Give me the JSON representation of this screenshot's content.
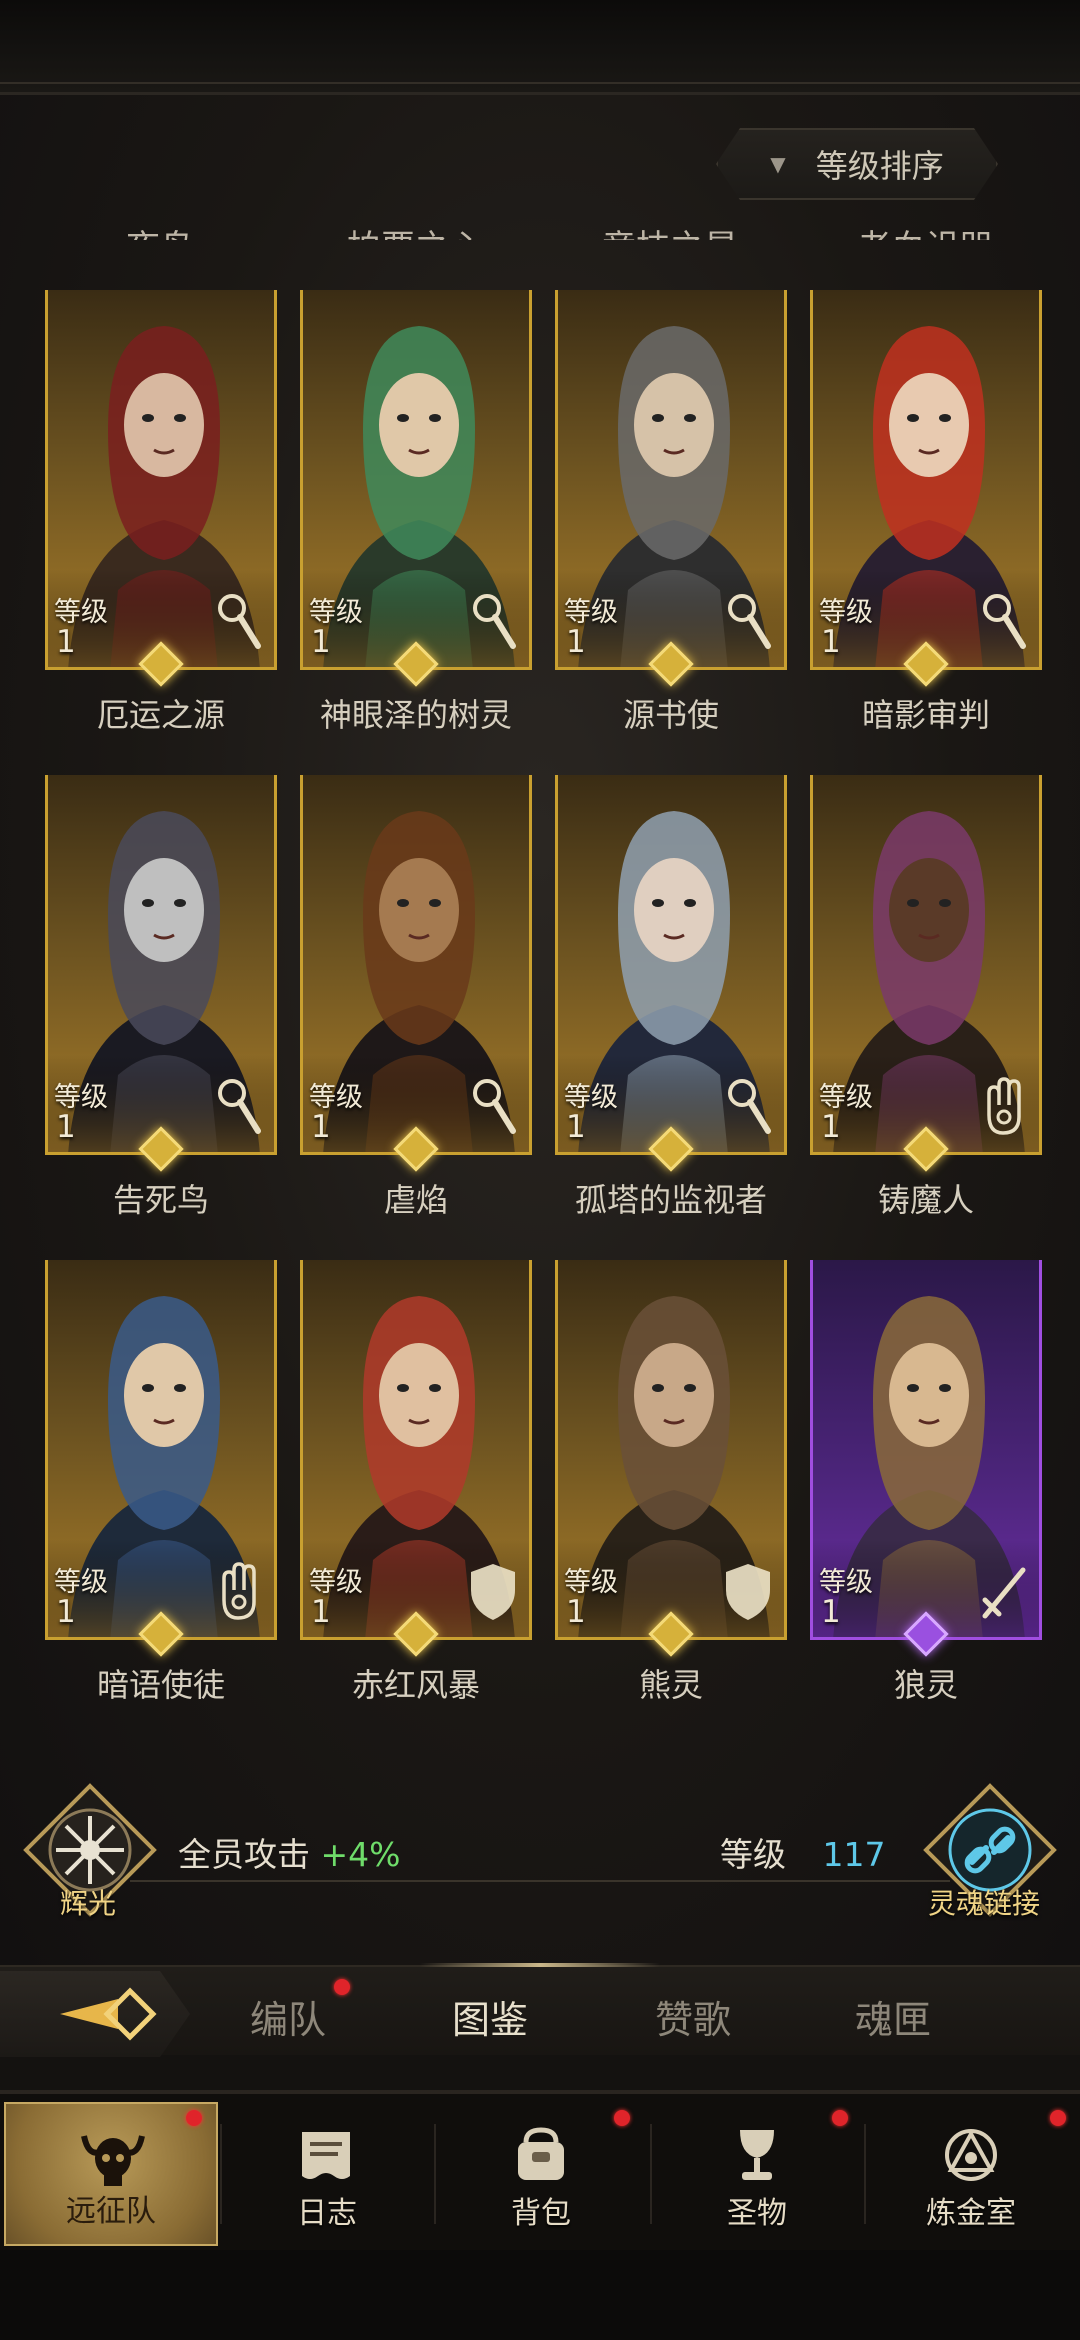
{
  "sort": {
    "label": "等级排序"
  },
  "cut_names": [
    "夜鸟",
    "柏要之心",
    "竞技之星",
    "老血诅咒"
  ],
  "cards": [
    {
      "name": "厄运之源",
      "level_label": "等级",
      "level": "1",
      "class_icon": "magnifier-wand-icon",
      "rarity": "gold"
    },
    {
      "name": "神眼泽的树灵",
      "level_label": "等级",
      "level": "1",
      "class_icon": "magnifier-wand-icon",
      "rarity": "gold"
    },
    {
      "name": "源书使",
      "level_label": "等级",
      "level": "1",
      "class_icon": "magnifier-wand-icon",
      "rarity": "gold"
    },
    {
      "name": "暗影审判",
      "level_label": "等级",
      "level": "1",
      "class_icon": "magnifier-wand-icon",
      "rarity": "gold"
    },
    {
      "name": "告死鸟",
      "level_label": "等级",
      "level": "1",
      "class_icon": "magnifier-wand-icon",
      "rarity": "gold"
    },
    {
      "name": "虐焰",
      "level_label": "等级",
      "level": "1",
      "class_icon": "magnifier-wand-icon",
      "rarity": "gold"
    },
    {
      "name": "孤塔的监视者",
      "level_label": "等级",
      "level": "1",
      "class_icon": "magnifier-wand-icon",
      "rarity": "gold"
    },
    {
      "name": "铸魔人",
      "level_label": "等级",
      "level": "1",
      "class_icon": "hand-icon",
      "rarity": "gold"
    },
    {
      "name": "暗语使徒",
      "level_label": "等级",
      "level": "1",
      "class_icon": "hand-icon",
      "rarity": "gold"
    },
    {
      "name": "赤红风暴",
      "level_label": "等级",
      "level": "1",
      "class_icon": "shield-icon",
      "rarity": "gold"
    },
    {
      "name": "熊灵",
      "level_label": "等级",
      "level": "1",
      "class_icon": "shield-icon",
      "rarity": "gold"
    },
    {
      "name": "狼灵",
      "level_label": "等级",
      "level": "1",
      "class_icon": "sword-icon",
      "rarity": "purple"
    }
  ],
  "bonus": {
    "left_emblem_label": "辉光",
    "effect_label": "全员攻击",
    "effect_value": "+4%",
    "level_label": "等级",
    "level_value": "117",
    "right_emblem_label": "灵魂链接"
  },
  "tabs": [
    {
      "label": "编队",
      "active": false,
      "badge": true
    },
    {
      "label": "图鉴",
      "active": true,
      "badge": false
    },
    {
      "label": "赞歌",
      "active": false,
      "badge": false
    },
    {
      "label": "魂匣",
      "active": false,
      "badge": false
    }
  ],
  "nav": [
    {
      "label": "远征队",
      "icon": "horned-skull-icon",
      "active": true,
      "badge": true
    },
    {
      "label": "日志",
      "icon": "scroll-icon",
      "active": false,
      "badge": true
    },
    {
      "label": "背包",
      "icon": "bag-icon",
      "active": false,
      "badge": true
    },
    {
      "label": "圣物",
      "icon": "chalice-icon",
      "active": false,
      "badge": true
    },
    {
      "label": "炼金室",
      "icon": "alchemy-icon",
      "active": false,
      "badge": false
    }
  ],
  "colors": {
    "gold_frame": "#c9a030",
    "purple_frame": "#a04ee0",
    "bonus_green": "#6fdc6a",
    "level_cyan": "#5ec8e8",
    "badge_red": "#e0242a"
  }
}
